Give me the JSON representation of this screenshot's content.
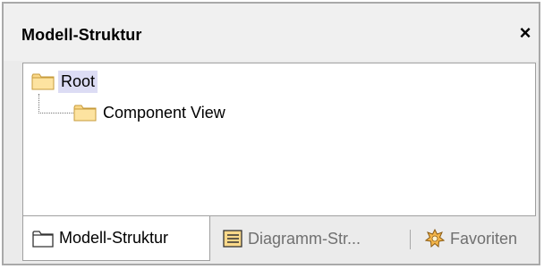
{
  "panel": {
    "title": "Modell-Struktur",
    "close_label": "×"
  },
  "tree": {
    "root": {
      "label": "Root",
      "icon": "folder-icon"
    },
    "children": [
      {
        "label": "Component View",
        "icon": "folder-icon"
      }
    ]
  },
  "tabs": [
    {
      "label": "Modell-Struktur",
      "icon": "folder-outline-icon",
      "active": true
    },
    {
      "label": "Diagramm-Str...",
      "icon": "diagram-tree-icon",
      "active": false
    },
    {
      "label": "Favoriten",
      "icon": "star-badge-icon",
      "active": false
    }
  ],
  "colors": {
    "selection": "#dcdcf4",
    "folder_fill": "#fbd98a",
    "folder_border": "#c79b3b",
    "inactive_tab_text": "#707070"
  }
}
